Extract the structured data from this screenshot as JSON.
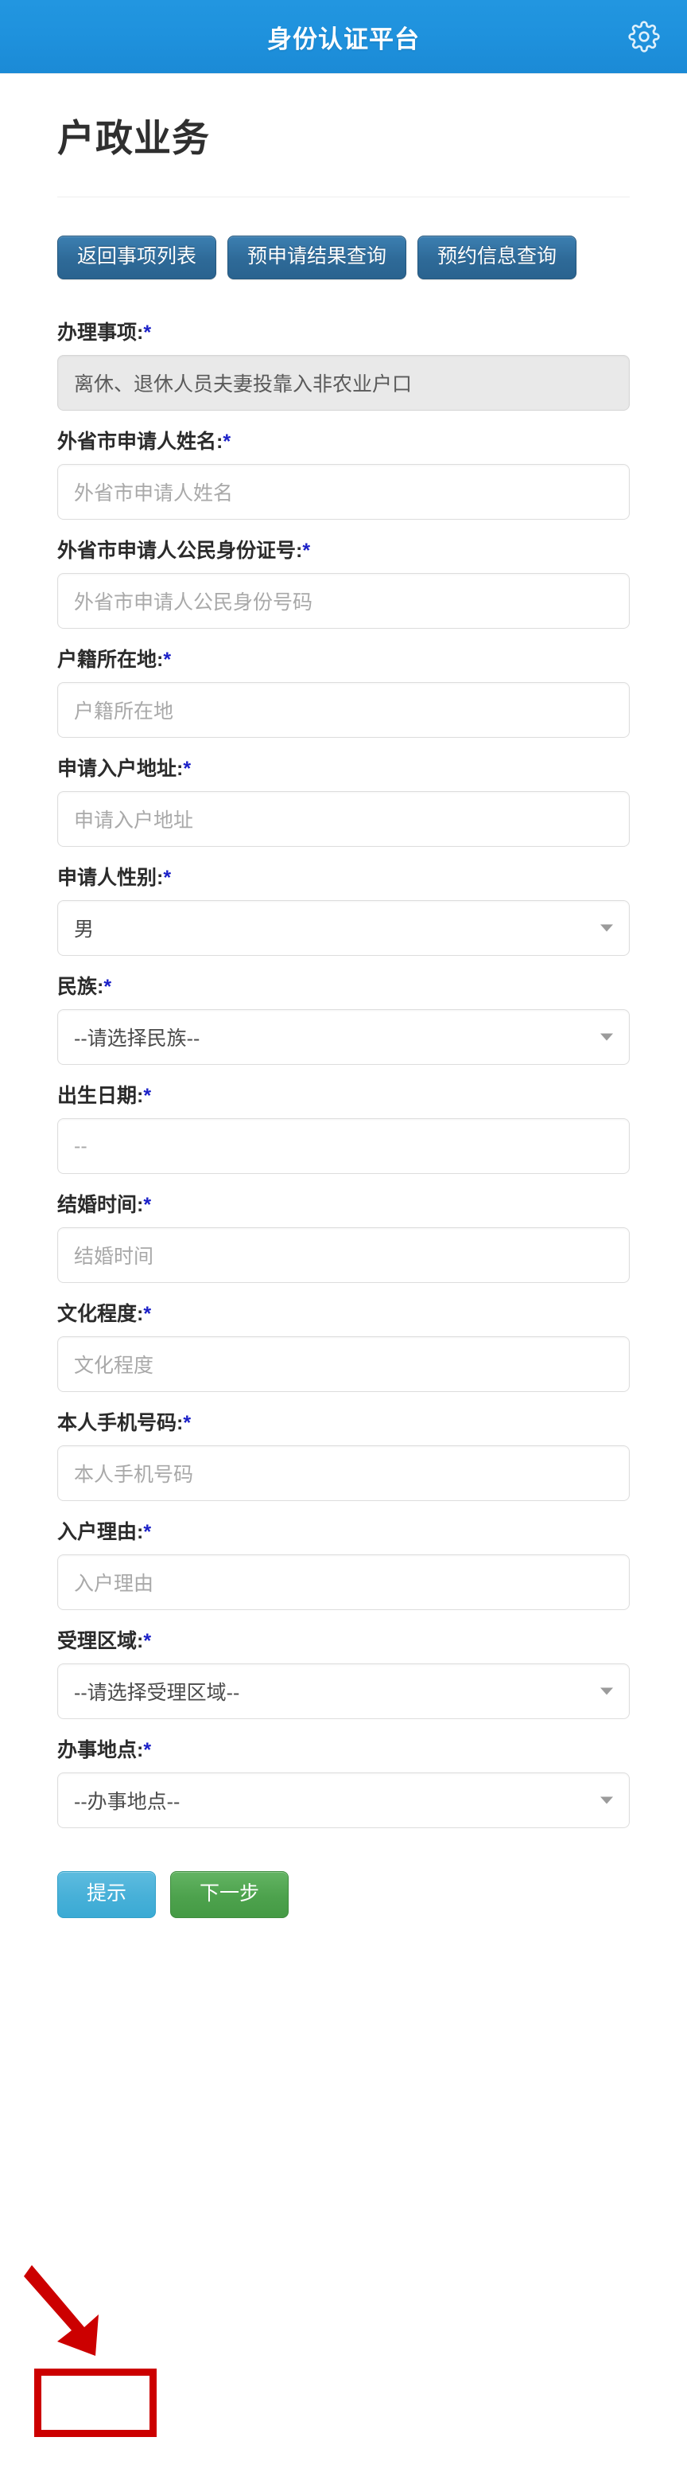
{
  "appbar": {
    "title": "身份认证平台",
    "gear_icon": "gear-icon"
  },
  "page": {
    "title": "户政业务"
  },
  "nav_buttons": [
    {
      "label": "返回事项列表"
    },
    {
      "label": "预申请结果查询"
    },
    {
      "label": "预约信息查询"
    }
  ],
  "form": {
    "required_mark": "*",
    "fields": [
      {
        "label": "办理事项:",
        "type": "readonly",
        "value": "离休、退休人员夫妻投靠入非农业户口",
        "name": "handling-matter"
      },
      {
        "label": "外省市申请人姓名:",
        "type": "input",
        "value": "",
        "placeholder": "外省市申请人姓名",
        "name": "applicant-name"
      },
      {
        "label": "外省市申请人公民身份证号:",
        "type": "input",
        "value": "",
        "placeholder": "外省市申请人公民身份号码",
        "name": "applicant-id-number"
      },
      {
        "label": "户籍所在地:",
        "type": "input",
        "value": "",
        "placeholder": "户籍所在地",
        "name": "household-registration-location"
      },
      {
        "label": "申请入户地址:",
        "type": "input",
        "value": "",
        "placeholder": "申请入户地址",
        "name": "apply-settlement-address"
      },
      {
        "label": "申请人性别:",
        "type": "select",
        "value": "男",
        "placeholder": "",
        "name": "applicant-gender"
      },
      {
        "label": "民族:",
        "type": "select",
        "value": "--请选择民族--",
        "placeholder": "",
        "name": "ethnicity"
      },
      {
        "label": "出生日期:",
        "type": "input-placeholder",
        "value": "",
        "placeholder": "--",
        "name": "birth-date"
      },
      {
        "label": "结婚时间:",
        "type": "input",
        "value": "",
        "placeholder": "结婚时间",
        "name": "marriage-date"
      },
      {
        "label": "文化程度:",
        "type": "input",
        "value": "",
        "placeholder": "文化程度",
        "name": "education-level"
      },
      {
        "label": "本人手机号码:",
        "type": "input",
        "value": "",
        "placeholder": "本人手机号码",
        "name": "mobile-phone-number"
      },
      {
        "label": "入户理由:",
        "type": "input",
        "value": "",
        "placeholder": "入户理由",
        "name": "settlement-reason"
      },
      {
        "label": "受理区域:",
        "type": "select",
        "value": "--请选择受理区域--",
        "placeholder": "",
        "name": "acceptance-area"
      },
      {
        "label": "办事地点:",
        "type": "select",
        "value": "--办事地点--",
        "placeholder": "",
        "name": "service-location"
      }
    ]
  },
  "actions": {
    "hint_label": "提示",
    "next_label": "下一步"
  },
  "annotation": {
    "highlight_color": "#cc0000",
    "arrow_color": "#cc0000"
  },
  "colors": {
    "appbar_blue": "#1f92dd",
    "nav_button_blue": "#2e6a98",
    "hint_button_blue": "#47b0d8",
    "next_button_green": "#4da24d",
    "required_asterisk": "#1c21c8"
  }
}
